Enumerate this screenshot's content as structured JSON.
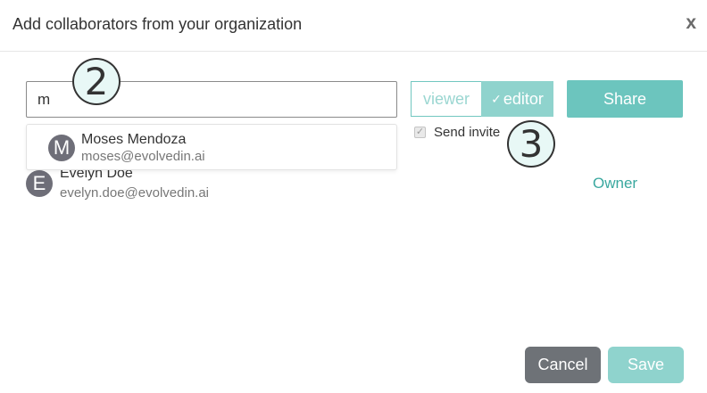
{
  "dialog": {
    "title": "Add collaborators from your organization",
    "close_label": "x"
  },
  "search": {
    "value": "m",
    "placeholder": ""
  },
  "annotations": {
    "step_2": "2",
    "step_3": "3"
  },
  "role_toggle": {
    "options": [
      "viewer",
      "editor"
    ],
    "selected": "editor",
    "check_glyph": "✓"
  },
  "share_button": {
    "label": "Share"
  },
  "send_invite": {
    "label": "Send invite",
    "checked": true,
    "check_glyph": "✓"
  },
  "suggestion": {
    "initial": "M",
    "name": "Moses Mendoza",
    "email": "moses@evolvedin.ai"
  },
  "members": [
    {
      "initial": "E",
      "name": "Evelyn Doe",
      "email": "evelyn.doe@evolvedin.ai",
      "role": "Owner"
    }
  ],
  "footer": {
    "cancel_label": "Cancel",
    "save_label": "Save"
  },
  "colors": {
    "accent": "#6cc5be",
    "accent_light": "#8fd3cd",
    "owner_text": "#3aa89f",
    "cancel_bg": "#6e7277",
    "avatar_bg": "#6e6e78"
  }
}
